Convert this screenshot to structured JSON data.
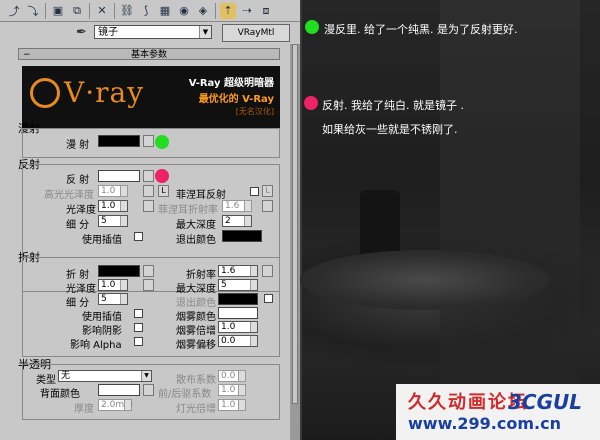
{
  "toolbar": {
    "icons": [
      "pick-icon",
      "put-icon",
      "assign-icon",
      "reset-icon",
      "copy-icon",
      "unique-icon",
      "put-library-icon",
      "effects-channel-icon",
      "show-map-icon",
      "show-end-icon",
      "go-parent-icon",
      "go-sibling-icon"
    ]
  },
  "material": {
    "name": "镜子",
    "type": "VRayMtl"
  },
  "rollout": {
    "title": "基本参数"
  },
  "logo": {
    "brand": "V·ray",
    "line1": "V-Ray 超级明暗器",
    "line2": "最优化的 V-Ray",
    "line3": "[无名汉化]"
  },
  "diffuse": {
    "title": "漫射",
    "label": "漫 射",
    "color": "#000000"
  },
  "reflection": {
    "title": "反射",
    "label": "反 射",
    "color": "#ffffff",
    "hilight_gloss_label": "高光光泽度",
    "hilight_gloss_value": "1.0",
    "l_button": "L",
    "fresnel_label": "菲涅耳反射",
    "refl_gloss_label": "光泽度",
    "refl_gloss_value": "1.0",
    "fresnel_ior_label": "菲涅耳折射率",
    "fresnel_ior_value": "1.6",
    "subdivs_label": "细 分",
    "subdivs_value": "5",
    "max_depth_label": "最大深度",
    "max_depth_value": "2",
    "use_interp_label": "使用插值",
    "exit_color_label": "退出颜色",
    "exit_color": "#000000"
  },
  "refraction": {
    "title": "折射",
    "label": "折 射",
    "color": "#000000",
    "ior_label": "折射率",
    "ior_value": "1.6",
    "gloss_label": "光泽度",
    "gloss_value": "1.0",
    "max_depth_label": "最大深度",
    "max_depth_value": "5",
    "subdivs_label": "细 分",
    "subdivs_value": "5",
    "exit_color_label": "退出颜色",
    "exit_color": "#000000",
    "use_interp_label": "使用插值",
    "fog_color_label": "烟雾颜色",
    "fog_color": "#ffffff",
    "affect_shadows_label": "影响阴影",
    "fog_mult_label": "烟雾倍增",
    "fog_mult_value": "1.0",
    "affect_alpha_label": "影响 Alpha",
    "fog_bias_label": "烟雾偏移",
    "fog_bias_value": "0.0"
  },
  "translucency": {
    "title": "半透明",
    "type_label": "类型",
    "type_value": "无",
    "scatter_label": "散布系数",
    "scatter_value": "0.0",
    "back_color_label": "背面颜色",
    "back_color": "#ffffff",
    "fwd_back_label": "前/后驱系数",
    "fwd_back_value": "1.0",
    "thickness_label": "厚度",
    "thickness_value": "2.0mm",
    "light_mult_label": "灯光倍增",
    "light_mult_value": "1.0"
  },
  "annotations": {
    "green_dot_color": "#22dd22",
    "pink_dot_color": "#ee2266",
    "note1": "漫反里. 给了一个纯黑. 是为了反射更好.",
    "note2_line1": "反射. 我给了纯白. 就是镜子 .",
    "note2_line2": "如果给灰一些就是不锈刚了."
  },
  "watermark": {
    "line1": "久久动画论坛",
    "line2": "www.299.com.cn",
    "logo_text": "3CGUL"
  }
}
